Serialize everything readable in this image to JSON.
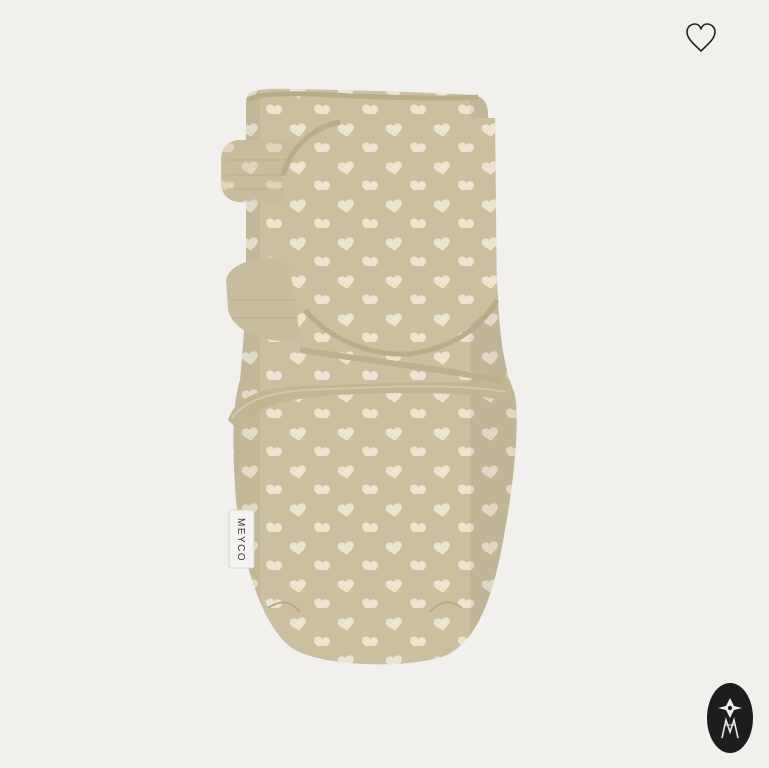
{
  "product": {
    "label_text": "MEYCO",
    "fabric_color": "#cbbf9f",
    "fabric_shadow": "#b7ab8b",
    "trim_color": "#c2b594",
    "heart_color": "#ede6d4",
    "background_color": "#f1f0ed"
  },
  "wishlist": {
    "icon": "heart-outline-icon"
  },
  "badge": {
    "icon": "brand-logo-icon"
  }
}
